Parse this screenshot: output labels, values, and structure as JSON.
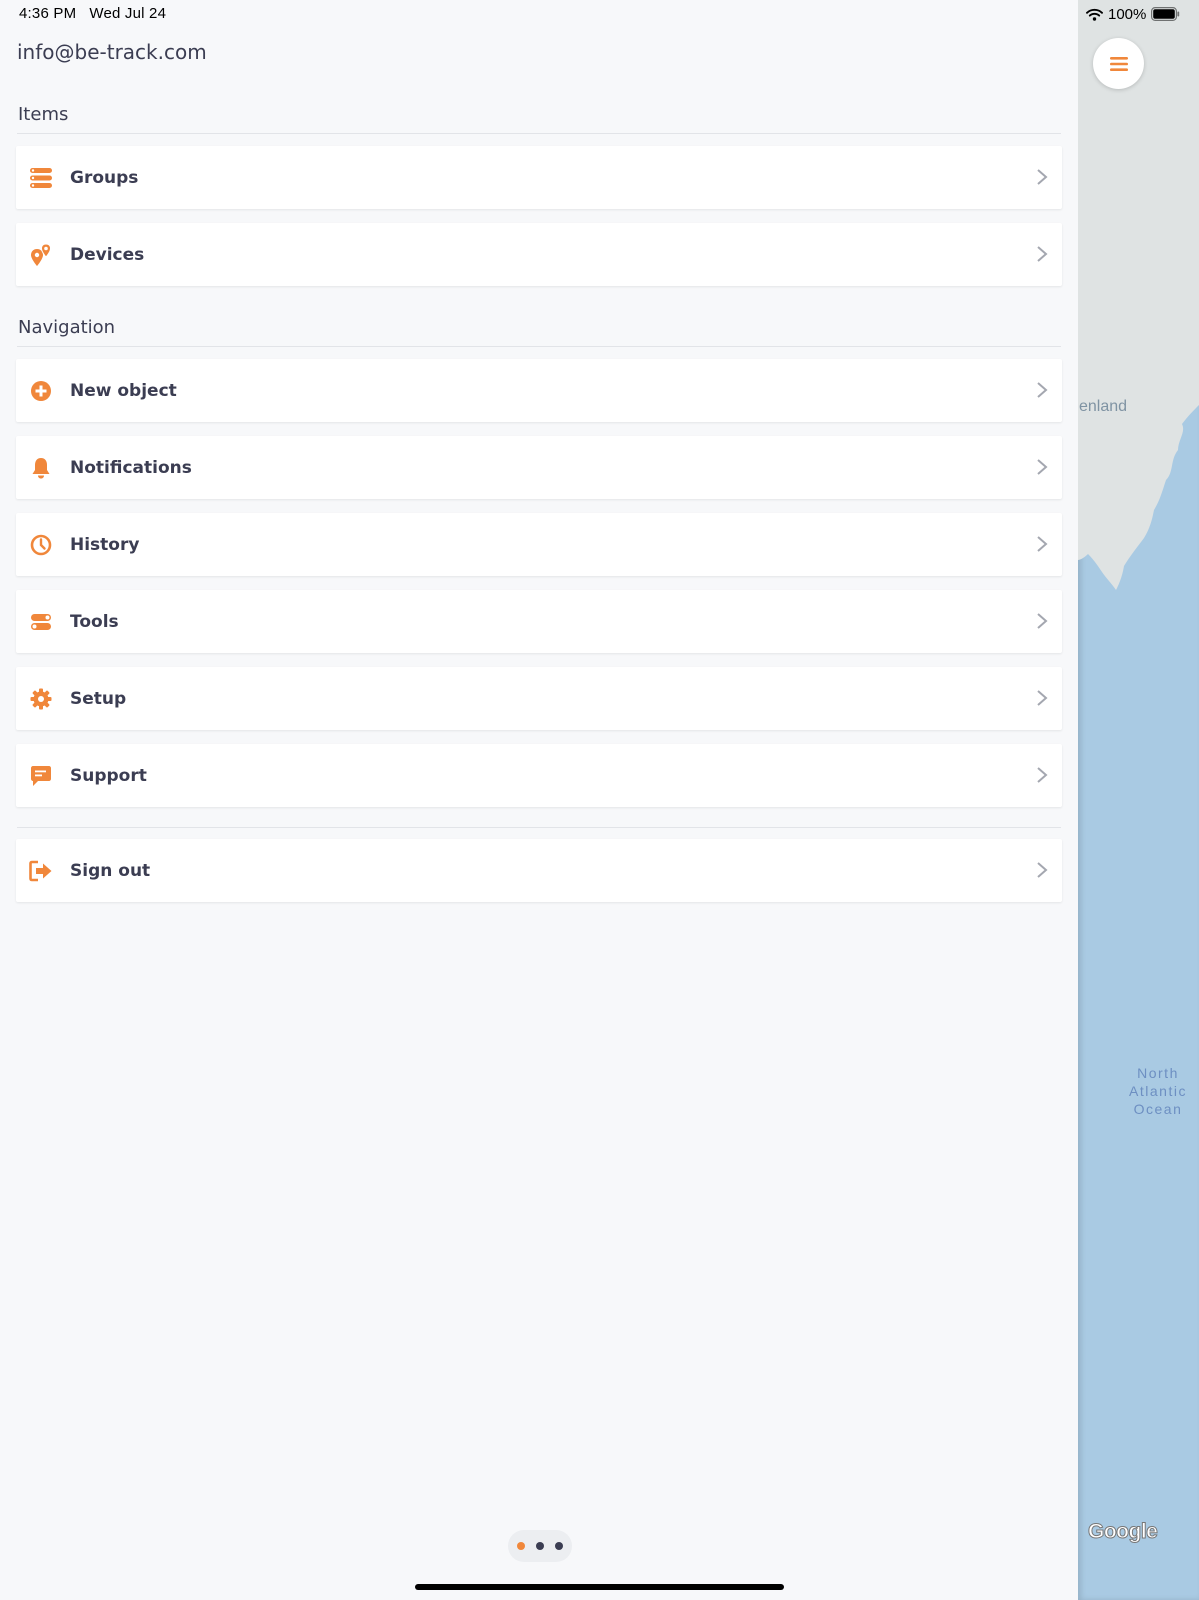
{
  "status_bar": {
    "time": "4:36 PM",
    "date": "Wed Jul 24",
    "battery": "100%"
  },
  "account": {
    "email": "info@be-track.com"
  },
  "sections": {
    "items": {
      "title": "Items",
      "entries": [
        {
          "label": "Groups",
          "icon": "layers-icon"
        },
        {
          "label": "Devices",
          "icon": "map-pins-icon"
        }
      ]
    },
    "navigation": {
      "title": "Navigation",
      "entries": [
        {
          "label": "New object",
          "icon": "plus-circle-icon"
        },
        {
          "label": "Notifications",
          "icon": "bell-icon"
        },
        {
          "label": "History",
          "icon": "clock-icon"
        },
        {
          "label": "Tools",
          "icon": "toggles-icon"
        },
        {
          "label": "Setup",
          "icon": "gear-icon"
        },
        {
          "label": "Support",
          "icon": "chat-icon"
        }
      ]
    },
    "account_actions": {
      "entries": [
        {
          "label": "Sign out",
          "icon": "sign-out-icon"
        }
      ]
    }
  },
  "map": {
    "land_label": "enland",
    "ocean_label": [
      "North",
      "Atlantic",
      "Ocean"
    ],
    "attribution": "Google"
  },
  "pager": {
    "pages": 3,
    "active_index": 0
  },
  "colors": {
    "accent": "#f0873b",
    "text": "#3b3d52",
    "background": "#f7f8fa",
    "ocean": "#a9cae3",
    "land": "#dfe3e3"
  }
}
